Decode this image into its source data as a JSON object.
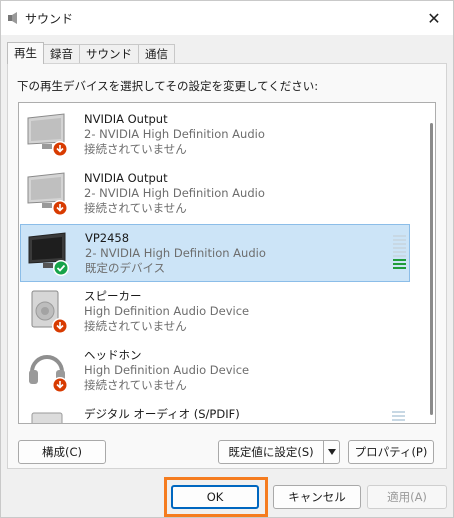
{
  "window": {
    "title": "サウンド"
  },
  "tabs": [
    {
      "label": "再生"
    },
    {
      "label": "録音"
    },
    {
      "label": "サウンド"
    },
    {
      "label": "通信"
    }
  ],
  "instruction": "下の再生デバイスを選択してその設定を変更してください:",
  "devices": [
    {
      "name": "NVIDIA Output",
      "driver": "2- NVIDIA High Definition Audio",
      "status": "接続されていません",
      "icon": "monitor-icon",
      "badge": "disconnected"
    },
    {
      "name": "NVIDIA Output",
      "driver": "2- NVIDIA High Definition Audio",
      "status": "接続されていません",
      "icon": "monitor-icon",
      "badge": "disconnected"
    },
    {
      "name": "VP2458",
      "driver": "2- NVIDIA High Definition Audio",
      "status": "既定のデバイス",
      "icon": "monitor-icon",
      "badge": "default",
      "selected": true
    },
    {
      "name": "スピーカー",
      "driver": "High Definition Audio Device",
      "status": "接続されていません",
      "icon": "speaker-icon",
      "badge": "disconnected"
    },
    {
      "name": "ヘッドホン",
      "driver": "High Definition Audio Device",
      "status": "接続されていません",
      "icon": "headphones-icon",
      "badge": "disconnected"
    },
    {
      "name": "デジタル オーディオ (S/PDIF)",
      "driver": "",
      "status": "",
      "icon": "digital-audio-icon",
      "badge": "none"
    }
  ],
  "buttons": {
    "configure": "構成(C)",
    "set_default": "既定値に設定(S)",
    "properties": "プロパティ(P)",
    "ok": "OK",
    "cancel": "キャンセル",
    "apply": "適用(A)"
  },
  "colors": {
    "selection": "#cce4f7",
    "disconnected_badge": "#d83b01",
    "default_badge": "#16a34a",
    "ok_highlight": "#f57c1f"
  }
}
